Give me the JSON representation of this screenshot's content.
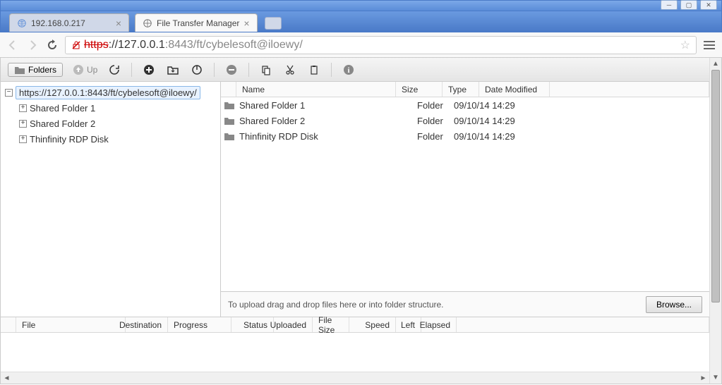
{
  "window": {
    "tabs": [
      {
        "title": "192.168.0.217",
        "active": false
      },
      {
        "title": "File Transfer Manager",
        "active": true
      }
    ],
    "url_prefix": "https",
    "url_domain": "://127.0.0.1",
    "url_port": ":8443",
    "url_path": "/ft/cybelesoft@iloewy/"
  },
  "toolbar": {
    "folders_label": "Folders",
    "up_label": "Up"
  },
  "tree": {
    "root": "https://127.0.0.1:8443/ft/cybelesoft@iloewy/",
    "children": [
      "Shared Folder 1",
      "Shared Folder 2",
      "Thinfinity RDP Disk"
    ]
  },
  "file_headers": {
    "name": "Name",
    "size": "Size",
    "type": "Type",
    "date": "Date Modified"
  },
  "files": [
    {
      "name": "Shared Folder 1",
      "size": "",
      "type": "Folder",
      "date": "09/10/14 14:29"
    },
    {
      "name": "Shared Folder 2",
      "size": "",
      "type": "Folder",
      "date": "09/10/14 14:29"
    },
    {
      "name": "Thinfinity RDP Disk",
      "size": "",
      "type": "Folder",
      "date": "09/10/14 14:29"
    }
  ],
  "dropbar": {
    "text": "To upload drag and drop files here or into folder structure.",
    "browse": "Browse..."
  },
  "progress_headers": {
    "file": "File",
    "destination": "Destination",
    "progress": "Progress",
    "status": "Status",
    "uploaded": "Uploaded",
    "filesize": "File Size",
    "speed": "Speed",
    "left": "Left",
    "elapsed": "Elapsed"
  }
}
